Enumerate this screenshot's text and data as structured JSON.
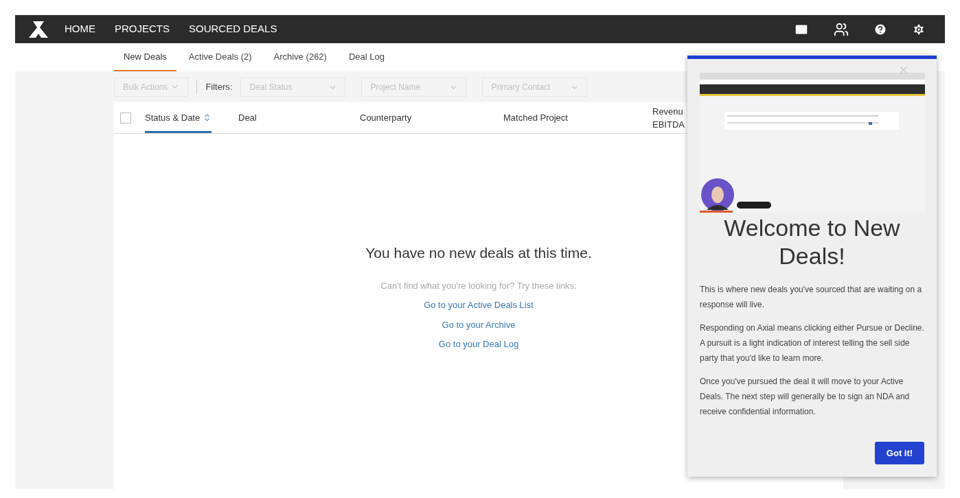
{
  "nav": {
    "items": [
      {
        "label": "HOME"
      },
      {
        "label": "PROJECTS"
      },
      {
        "label": "SOURCED DEALS"
      }
    ]
  },
  "tabs": [
    {
      "label": "New Deals",
      "selected": true
    },
    {
      "label": "Active Deals (2)",
      "selected": false
    },
    {
      "label": "Archive (262)",
      "selected": false
    },
    {
      "label": "Deal Log",
      "selected": false
    }
  ],
  "toolbar": {
    "bulk_actions": "Bulk Actions",
    "filters_label": "Filters:",
    "filters": [
      {
        "placeholder": "Deal Status"
      },
      {
        "placeholder": "Project Name"
      },
      {
        "placeholder": "Primary Contact"
      }
    ]
  },
  "table": {
    "select_all_checked": false,
    "columns": [
      {
        "label": "Status & Date",
        "sorted": true
      },
      {
        "label": "Deal",
        "sorted": false
      },
      {
        "label": "Counterparty",
        "sorted": false
      },
      {
        "label": "Matched Project",
        "sorted": false
      },
      {
        "label": "Revenu\nEBITDA",
        "sorted": false
      }
    ]
  },
  "empty_state": {
    "title": "You have no new deals at this time.",
    "hint": "Can't find what you're looking for? Try these links:",
    "links": [
      "Go to your Active Deals List",
      "Go to your Archive",
      "Go to your Deal Log"
    ]
  },
  "popover": {
    "video": {
      "kind": "picture"
    },
    "title": "Welcome to New Deals!",
    "paragraphs": [
      "This is where new deals you've sourced that are waiting on a response will live.",
      "Responding on Axial means clicking either Pursue or Decline. A pursuit is a light indication of interest telling the sell side party that you'd like to learn more.",
      "Once you've pursued the deal it will move to your Active Deals. The next step will generally be to sign an NDA and receive confidential information."
    ],
    "button": "Got it!"
  }
}
